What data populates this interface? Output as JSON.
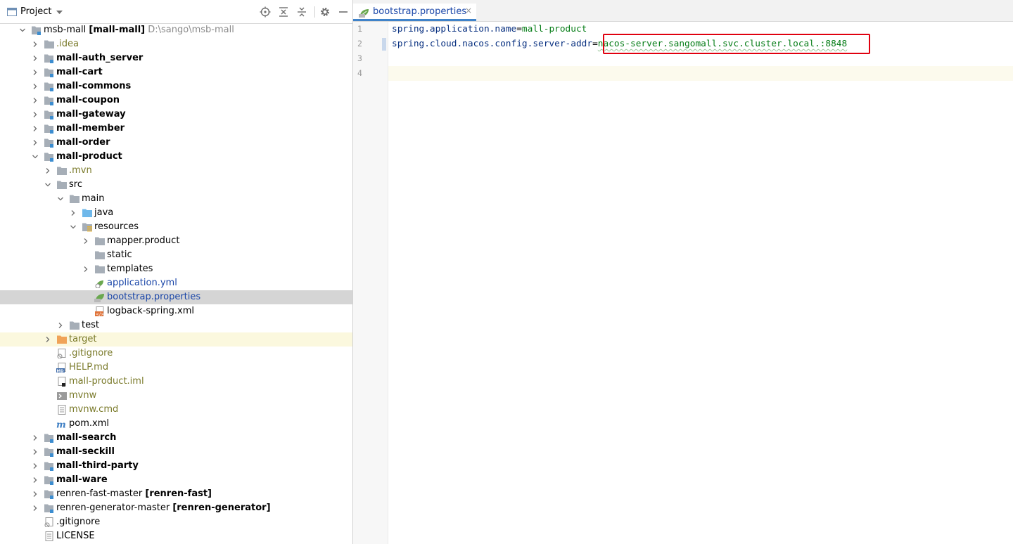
{
  "project_panel": {
    "title": "Project",
    "tools": [
      "locate-icon",
      "expand-all-icon",
      "collapse-all-icon",
      "gear-icon",
      "hide-icon"
    ]
  },
  "tree": [
    {
      "depth": 0,
      "expanded": true,
      "kind": "module",
      "label": "msb-mall",
      "bold_suffix": "[mall-mall]",
      "hint": "D:\\sango\\msb-mall"
    },
    {
      "depth": 1,
      "expanded": false,
      "kind": "folder",
      "label": ".idea",
      "color": "olive"
    },
    {
      "depth": 1,
      "expanded": false,
      "kind": "module",
      "label": "mall-auth_server",
      "bold": true
    },
    {
      "depth": 1,
      "expanded": false,
      "kind": "module",
      "label": "mall-cart",
      "bold": true
    },
    {
      "depth": 1,
      "expanded": false,
      "kind": "module",
      "label": "mall-commons",
      "bold": true
    },
    {
      "depth": 1,
      "expanded": false,
      "kind": "module",
      "label": "mall-coupon",
      "bold": true
    },
    {
      "depth": 1,
      "expanded": false,
      "kind": "module",
      "label": "mall-gateway",
      "bold": true
    },
    {
      "depth": 1,
      "expanded": false,
      "kind": "module",
      "label": "mall-member",
      "bold": true
    },
    {
      "depth": 1,
      "expanded": false,
      "kind": "module",
      "label": "mall-order",
      "bold": true
    },
    {
      "depth": 1,
      "expanded": true,
      "kind": "module",
      "label": "mall-product",
      "bold": true
    },
    {
      "depth": 2,
      "expanded": false,
      "kind": "folder",
      "label": ".mvn",
      "color": "olive"
    },
    {
      "depth": 2,
      "expanded": true,
      "kind": "folder",
      "label": "src"
    },
    {
      "depth": 3,
      "expanded": true,
      "kind": "folder",
      "label": "main"
    },
    {
      "depth": 4,
      "expanded": false,
      "kind": "source-folder",
      "label": "java"
    },
    {
      "depth": 4,
      "expanded": true,
      "kind": "resources-folder",
      "label": "resources"
    },
    {
      "depth": 5,
      "expanded": false,
      "kind": "folder",
      "label": "mapper.product"
    },
    {
      "depth": 5,
      "expanded": null,
      "kind": "folder",
      "label": "static"
    },
    {
      "depth": 5,
      "expanded": false,
      "kind": "folder",
      "label": "templates"
    },
    {
      "depth": 5,
      "expanded": null,
      "kind": "yml-file",
      "label": "application.yml",
      "color": "blue"
    },
    {
      "depth": 5,
      "expanded": null,
      "kind": "properties-file",
      "label": "bootstrap.properties",
      "color": "blue",
      "selected": true
    },
    {
      "depth": 5,
      "expanded": null,
      "kind": "xml-file",
      "label": "logback-spring.xml"
    },
    {
      "depth": 3,
      "expanded": false,
      "kind": "folder",
      "label": "test"
    },
    {
      "depth": 2,
      "expanded": false,
      "kind": "excluded-folder",
      "label": "target",
      "color": "olive",
      "excluded": true
    },
    {
      "depth": 2,
      "expanded": null,
      "kind": "gitignore-file",
      "label": ".gitignore",
      "color": "olive"
    },
    {
      "depth": 2,
      "expanded": null,
      "kind": "md-file",
      "label": "HELP.md",
      "color": "olive"
    },
    {
      "depth": 2,
      "expanded": null,
      "kind": "iml-file",
      "label": "mall-product.iml",
      "color": "olive"
    },
    {
      "depth": 2,
      "expanded": null,
      "kind": "script-file",
      "label": "mvnw",
      "color": "olive"
    },
    {
      "depth": 2,
      "expanded": null,
      "kind": "text-file",
      "label": "mvnw.cmd",
      "color": "olive"
    },
    {
      "depth": 2,
      "expanded": null,
      "kind": "maven-file",
      "label": "pom.xml"
    },
    {
      "depth": 1,
      "expanded": false,
      "kind": "module",
      "label": "mall-search",
      "bold": true
    },
    {
      "depth": 1,
      "expanded": false,
      "kind": "module",
      "label": "mall-seckill",
      "bold": true
    },
    {
      "depth": 1,
      "expanded": false,
      "kind": "module",
      "label": "mall-third-party",
      "bold": true
    },
    {
      "depth": 1,
      "expanded": false,
      "kind": "module",
      "label": "mall-ware",
      "bold": true
    },
    {
      "depth": 1,
      "expanded": false,
      "kind": "module",
      "label": "renren-fast-master",
      "bold_suffix": "[renren-fast]"
    },
    {
      "depth": 1,
      "expanded": false,
      "kind": "module",
      "label": "renren-generator-master",
      "bold_suffix": "[renren-generator]"
    },
    {
      "depth": 1,
      "expanded": null,
      "kind": "gitignore-file",
      "label": ".gitignore"
    },
    {
      "depth": 1,
      "expanded": null,
      "kind": "text-file",
      "label": "LICENSE"
    }
  ],
  "editor": {
    "tab": {
      "label": "bootstrap.properties",
      "close": "×"
    },
    "line_numbers": [
      "1",
      "2",
      "3",
      "4"
    ],
    "lines": [
      {
        "key": "spring.application.name",
        "sep": "=",
        "value": "mall-product"
      },
      {
        "key": "spring.cloud.nacos.config.server-addr",
        "sep": "=",
        "value": "nacos-server.sangomall.svc.cluster.local.:8848"
      },
      {
        "key": "",
        "sep": "",
        "value": ""
      },
      {
        "key": "",
        "sep": "",
        "value": ""
      }
    ]
  },
  "colors": {
    "selection": "#d5d5d5",
    "excluded_row": "#fbf8de",
    "highlight_box": "#e0000f",
    "property_key": "#083080",
    "property_value": "#067d17",
    "tab_underline": "#4083c9"
  }
}
